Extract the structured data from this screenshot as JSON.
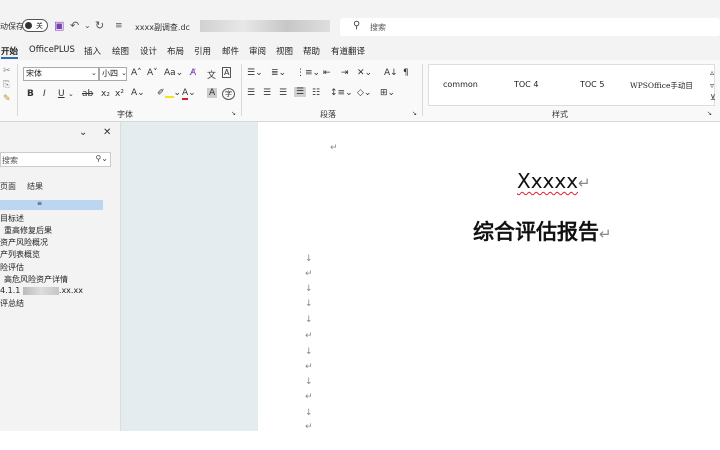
{
  "titlebar": {
    "autosave_label": "动保存",
    "toggle_label": "关",
    "doc_title": "xxxx副调查.dc",
    "search_placeholder": "搜索"
  },
  "menu": {
    "tabs": [
      "开始",
      "OfficePLUS",
      "插入",
      "绘图",
      "设计",
      "布局",
      "引用",
      "邮件",
      "审阅",
      "视图",
      "帮助",
      "有道翻译"
    ]
  },
  "ribbon": {
    "font_name": "宋体",
    "font_size": "小四",
    "group_font": "字体",
    "group_paragraph": "段落",
    "group_styles": "样式",
    "styles": [
      "common",
      "TOC 4",
      "TOC 5",
      "WPSOffice手动目"
    ]
  },
  "nav": {
    "search_placeholder": "搜索",
    "tabs": [
      "页面",
      "结果"
    ],
    "highlight_marker": "≡",
    "headings": [
      "目标述",
      "重高修复后果",
      "资产风险概况",
      "产列表概览",
      "险评估",
      "高危风险资产详情",
      "4.1.1",
      ".xx.xx",
      "评总结"
    ]
  },
  "document": {
    "title_line1": "Xxxxx",
    "title_line2": "综合评估报告",
    "paragraph_mark": "↵",
    "line_mark": "↓"
  }
}
